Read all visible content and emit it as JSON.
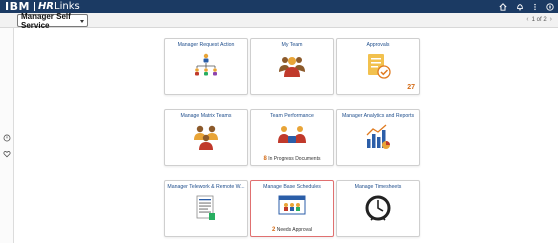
{
  "banner": {
    "brand_ibm": "IBM",
    "brand_hr": "HR",
    "brand_links": "Links",
    "icons": [
      "home-icon",
      "bell-icon",
      "more-vertical-icon",
      "compass-icon"
    ]
  },
  "toolbar": {
    "homepage_select": "Manager Self Service",
    "page_indicator": "1 of 2"
  },
  "rail": {
    "icons": [
      "timer-icon",
      "heart-icon"
    ]
  },
  "tiles": [
    {
      "title": "Manager Request Action",
      "icon": "org-chart-icon"
    },
    {
      "title": "My Team",
      "icon": "team-icon"
    },
    {
      "title": "Approvals",
      "icon": "approvals-icon",
      "count": "27"
    },
    {
      "title": "Manage Matrix Teams",
      "icon": "matrix-team-icon"
    },
    {
      "title": "Team Performance",
      "icon": "team-performance-icon",
      "foot_num": "8",
      "foot_text": "In Progress Documents"
    },
    {
      "title": "Manager Analytics and Reports",
      "icon": "analytics-icon"
    },
    {
      "title": "Manager Telework & Remote W...",
      "icon": "document-icon"
    },
    {
      "title": "Manage Base Schedules",
      "icon": "schedule-icon",
      "foot_num": "2",
      "foot_text": "Needs Approval",
      "selected": true
    },
    {
      "title": "Manage Timesheets",
      "icon": "clock-icon"
    }
  ],
  "colors": {
    "banner": "#1b3a63",
    "tile_title": "#1f4e8c",
    "count": "#d46b16",
    "selected_border": "#e07070"
  }
}
